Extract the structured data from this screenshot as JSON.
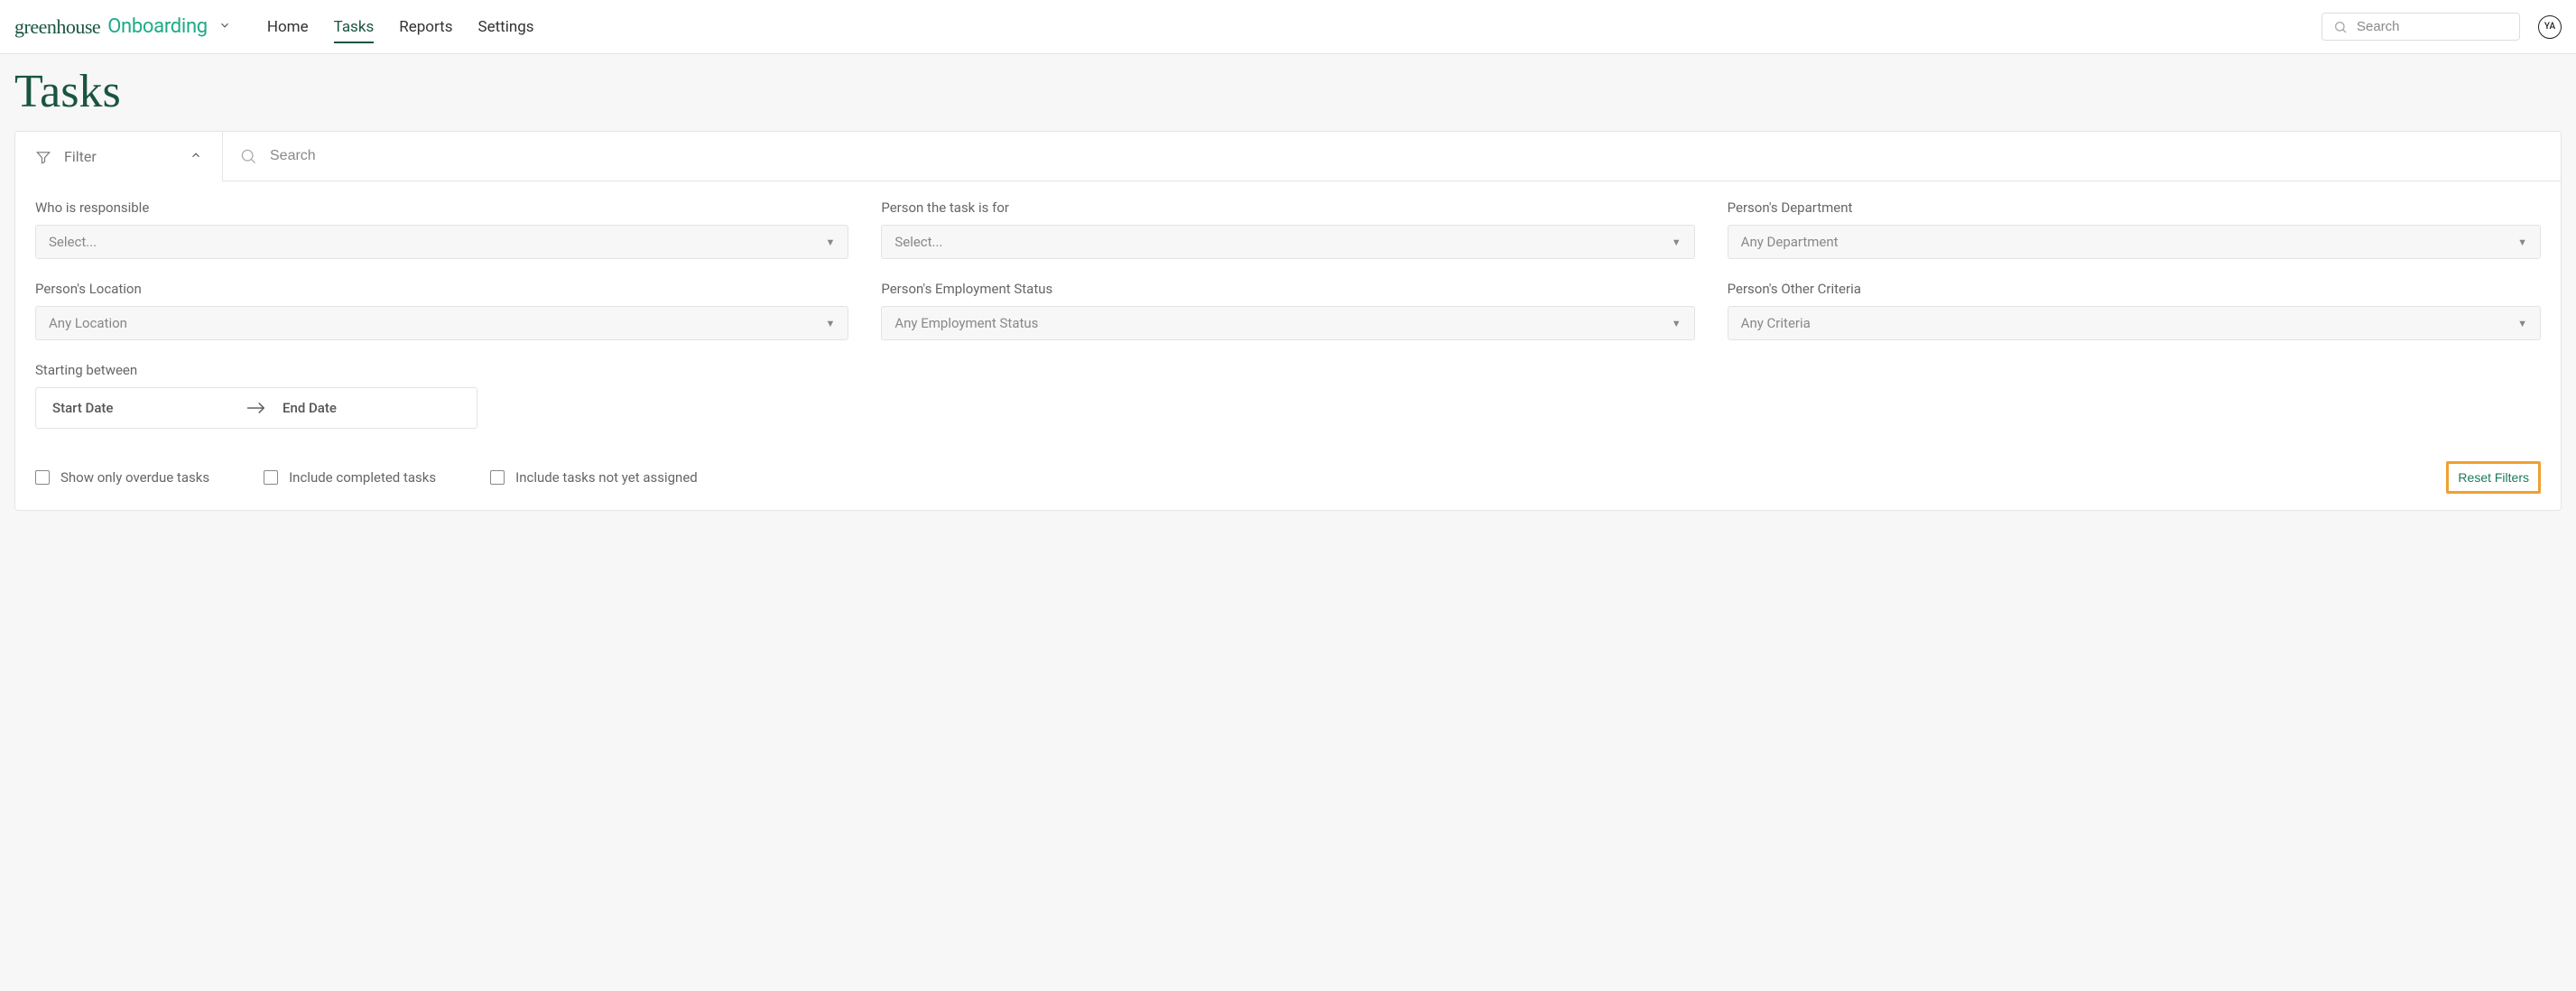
{
  "header": {
    "logo_primary": "greenhouse",
    "logo_secondary": "Onboarding",
    "nav": [
      {
        "label": "Home",
        "active": false
      },
      {
        "label": "Tasks",
        "active": true
      },
      {
        "label": "Reports",
        "active": false
      },
      {
        "label": "Settings",
        "active": false
      }
    ],
    "search_placeholder": "Search",
    "avatar_initials": "YA"
  },
  "page": {
    "title": "Tasks",
    "filter_label": "Filter",
    "filter_search_placeholder": "Search",
    "fields": {
      "responsible": {
        "label": "Who is responsible",
        "placeholder": "Select..."
      },
      "person_for": {
        "label": "Person the task is for",
        "placeholder": "Select..."
      },
      "department": {
        "label": "Person's Department",
        "placeholder": "Any Department"
      },
      "location": {
        "label": "Person's Location",
        "placeholder": "Any Location"
      },
      "employment_status": {
        "label": "Person's Employment Status",
        "placeholder": "Any Employment Status"
      },
      "other_criteria": {
        "label": "Person's Other Criteria",
        "placeholder": "Any Criteria"
      },
      "starting_between": {
        "label": "Starting between",
        "start": "Start Date",
        "end": "End Date"
      }
    },
    "checkboxes": {
      "overdue": "Show only overdue tasks",
      "completed": "Include completed tasks",
      "not_assigned": "Include tasks not yet assigned"
    },
    "reset_label": "Reset Filters"
  }
}
